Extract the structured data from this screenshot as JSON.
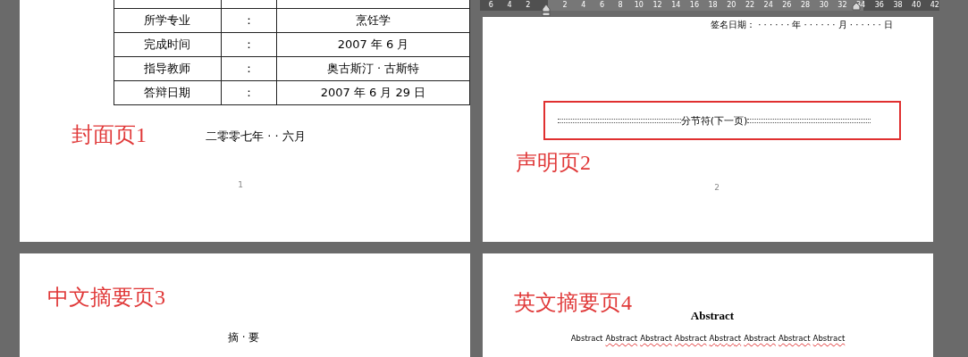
{
  "ruler": {
    "left_labels": [
      "6",
      "4",
      "2"
    ],
    "right_labels": [
      "2",
      "4",
      "6",
      "8",
      "10",
      "12",
      "14",
      "16",
      "18",
      "20",
      "22",
      "24",
      "26",
      "28",
      "30",
      "32",
      "34",
      "36",
      "38",
      "40",
      "42"
    ]
  },
  "pages": [
    {
      "kind": "cover",
      "heading": "封面页1",
      "table": {
        "rows": [
          {
            "label": "所学专业",
            "colon": "：",
            "value": "烹饪学"
          },
          {
            "label": "完成时间",
            "colon": "：",
            "value": "2007 年 6 月"
          },
          {
            "label": "指导教师",
            "colon": "：",
            "value": "奥古斯汀 · 古斯特"
          },
          {
            "label": "答辩日期",
            "colon": "：",
            "value": "2007 年 6 月 29 日"
          }
        ]
      },
      "date_line": "二零零七年 · · 六月",
      "page_number": "1"
    },
    {
      "kind": "statement",
      "signature_line": "签名日期： · · · · · · 年 · · · · · · 月 · · · · · · 日",
      "section_break": "分节符(下一页)",
      "heading": "声明页2",
      "page_number": "2"
    },
    {
      "kind": "chinese_abstract",
      "heading": "中文摘要页3",
      "title": "摘 · 要"
    },
    {
      "kind": "english_abstract",
      "heading": "英文摘要页4",
      "title": "Abstract",
      "words": [
        {
          "text": "Abstract",
          "misspelled": false
        },
        {
          "text": "Abstract",
          "misspelled": true
        },
        {
          "text": "Abstract",
          "misspelled": true
        },
        {
          "text": "Abstract",
          "misspelled": true
        },
        {
          "text": "Abstract",
          "misspelled": true
        },
        {
          "text": "Abstract",
          "misspelled": true
        },
        {
          "text": "Abstract",
          "misspelled": true
        },
        {
          "text": "Abstract",
          "misspelled": true
        }
      ]
    }
  ]
}
